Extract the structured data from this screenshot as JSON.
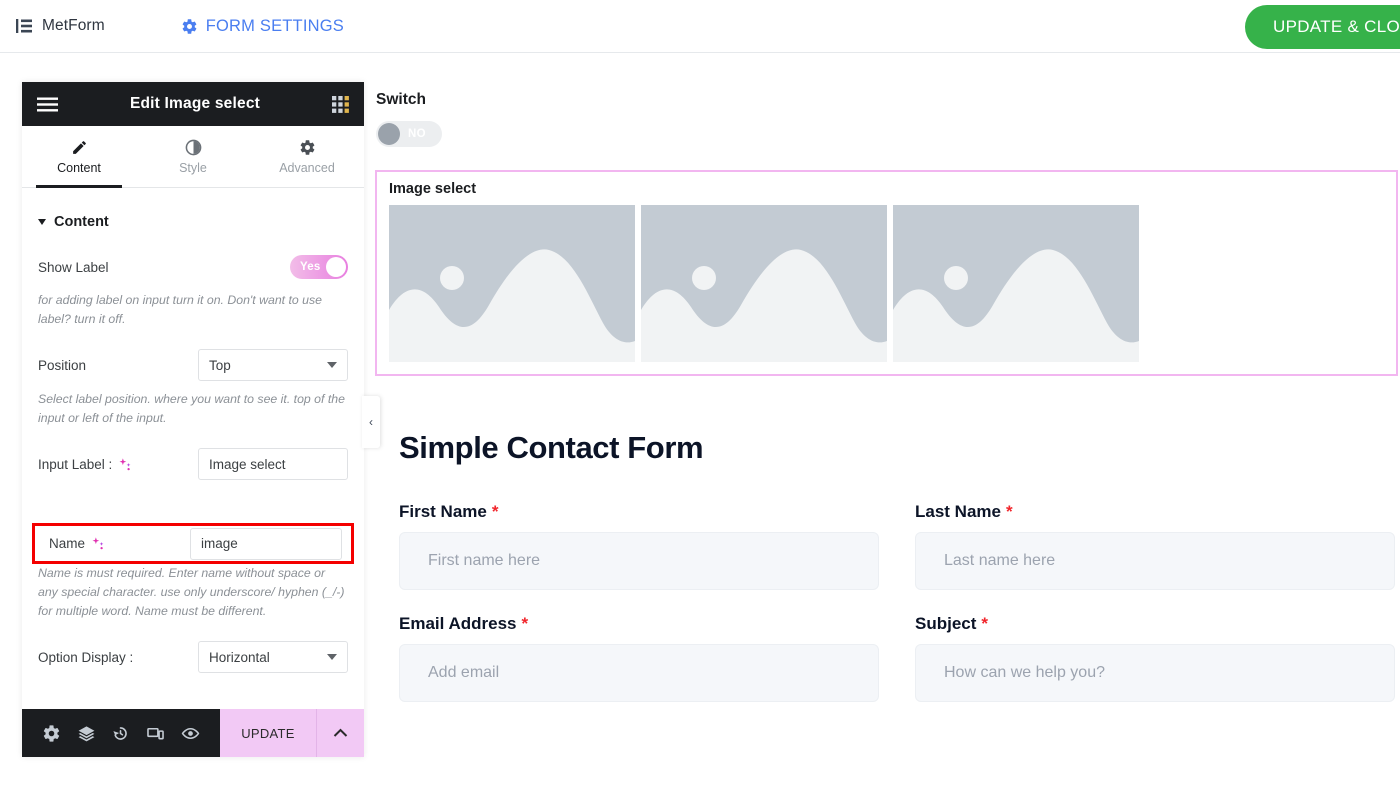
{
  "topbar": {
    "logo_icon": "list-icon",
    "brand": "MetForm",
    "settings_icon": "gear-icon",
    "settings_label": "FORM SETTINGS",
    "update_close_label": "UPDATE & CLOSE",
    "accent_blue": "#4a7ef0",
    "green": "#36b24a"
  },
  "panel": {
    "menu_icon": "hamburger-icon",
    "title": "Edit Image select",
    "grid_icon": "widgets-grid-icon",
    "tabs": [
      {
        "label": "Content",
        "icon": "pencil-icon",
        "active": true
      },
      {
        "label": "Style",
        "icon": "contrast-icon",
        "active": false
      },
      {
        "label": "Advanced",
        "icon": "gear-icon",
        "active": false
      }
    ],
    "section": {
      "title": "Content",
      "caret_icon": "caret-down-icon"
    },
    "show_label": {
      "label": "Show Label",
      "toggle_value": "Yes",
      "help": "for adding label on input turn it on. Don't want to use label? turn it off."
    },
    "position": {
      "label": "Position",
      "value": "Top",
      "help": "Select label position. where you want to see it. top of the input or left of the input."
    },
    "input_label": {
      "label": "Input Label :",
      "icon": "sparkle-icon",
      "value": "Image select"
    },
    "name": {
      "label": "Name",
      "icon": "sparkle-icon",
      "value": "image",
      "placeholder": "image",
      "highlight_color": "#f40000",
      "help": "Name is must required. Enter name without space or any special character. use only underscore/ hyphen (_/-) for multiple word. Name must be different."
    },
    "option_display": {
      "label": "Option Display :",
      "value": "Horizontal"
    },
    "footer": {
      "icons": [
        "gear-icon",
        "layers-icon",
        "history-icon",
        "responsive-device-icon",
        "eye-preview-icon"
      ],
      "update_label": "UPDATE",
      "caret_icon": "chevron-up-icon",
      "update_bg": "#f2c9f5"
    }
  },
  "collapse_handle": {
    "icon": "chevron-left-icon",
    "glyph": "‹"
  },
  "canvas": {
    "switch": {
      "title": "Switch",
      "toggle_value": "NO"
    },
    "image_widget": {
      "label": "Image select",
      "outline_color": "#f2b6f0",
      "thumbnails": [
        {
          "icon": "image-placeholder-icon"
        },
        {
          "icon": "image-placeholder-icon"
        },
        {
          "icon": "image-placeholder-icon"
        }
      ]
    },
    "form": {
      "title": "Simple Contact Form",
      "required_mark": "*",
      "fields": [
        {
          "label": "First Name",
          "required": true,
          "placeholder": "First name here",
          "value": "",
          "col": 0
        },
        {
          "label": "Last Name",
          "required": true,
          "placeholder": "Last name here",
          "value": "",
          "col": 1
        },
        {
          "label": "Email Address",
          "required": true,
          "placeholder": "Add email",
          "value": "",
          "col": 0
        },
        {
          "label": "Subject",
          "required": true,
          "placeholder": "How can we help you?",
          "value": "",
          "col": 1
        }
      ]
    }
  }
}
